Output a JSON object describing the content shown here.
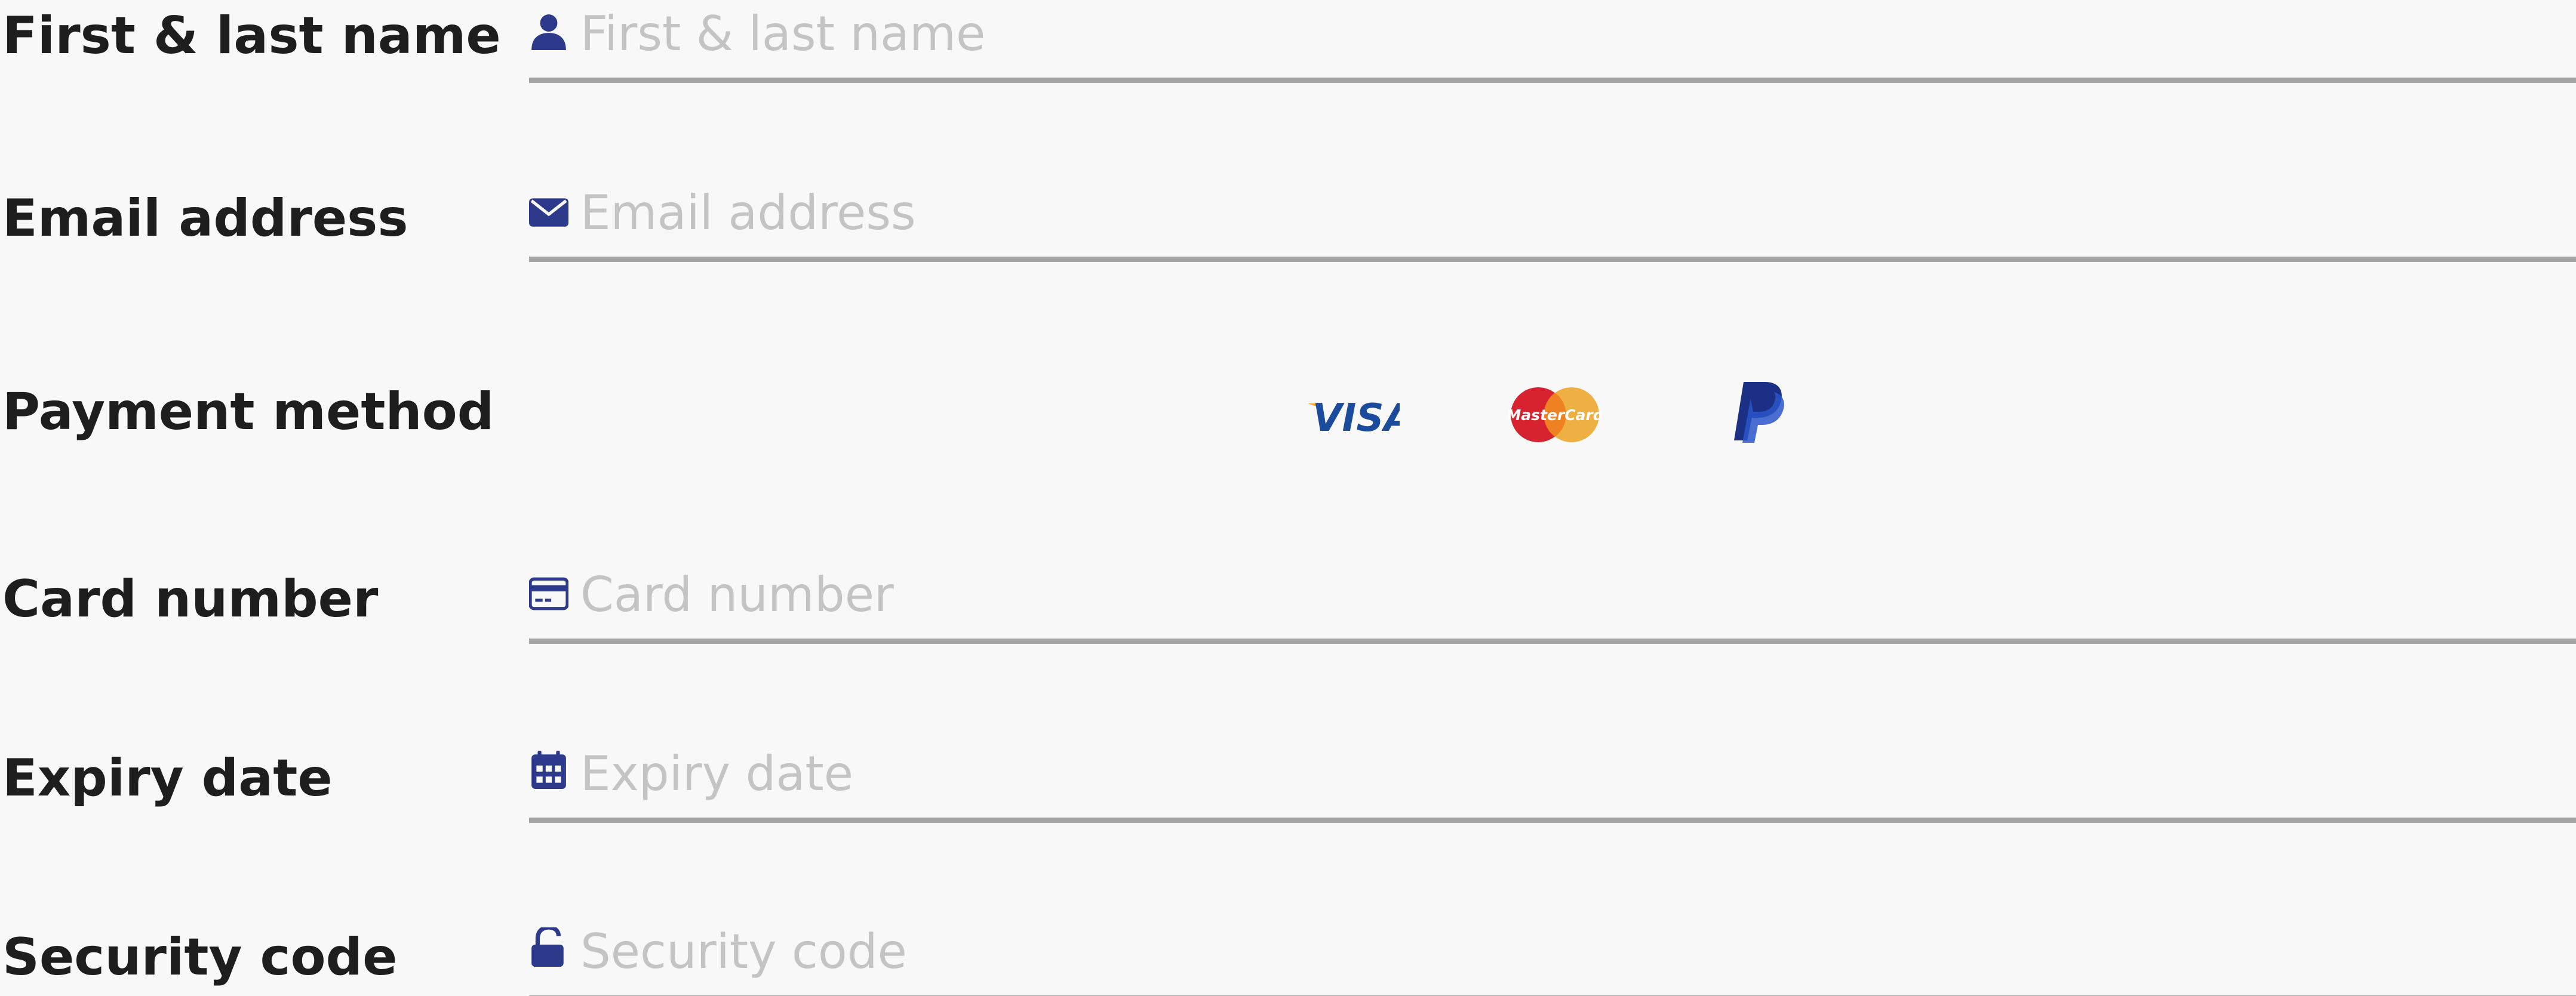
{
  "form": {
    "name": {
      "label": "First & last name",
      "placeholder": "First & last name",
      "icon": "person-icon"
    },
    "email": {
      "label": "Email address",
      "placeholder": "Email address",
      "icon": "envelope-icon"
    },
    "payment": {
      "label": "Payment method",
      "options": [
        {
          "name": "visa",
          "text": "VISA",
          "color": "#1a4b9c",
          "accent": "#f5a623"
        },
        {
          "name": "mastercard",
          "text": "MasterCard",
          "left_color": "#d6232f",
          "right_color": "#eeb043"
        },
        {
          "name": "paypal",
          "color_dark": "#1b2f84",
          "color_light": "#2a55c9"
        }
      ]
    },
    "card": {
      "label": "Card number",
      "placeholder": "Card number",
      "icon": "credit-card-icon"
    },
    "expiry": {
      "label": "Expiry date",
      "placeholder": "Expiry date",
      "icon": "calendar-icon"
    },
    "security": {
      "label": "Security code",
      "placeholder": "Security code",
      "icon": "unlock-icon"
    }
  },
  "colors": {
    "icon": "#2d3a8c",
    "label": "#1e1e1e",
    "placeholder": "#c4c4c4",
    "underline": "#a3a3a3",
    "background": "#f8f8f8"
  }
}
